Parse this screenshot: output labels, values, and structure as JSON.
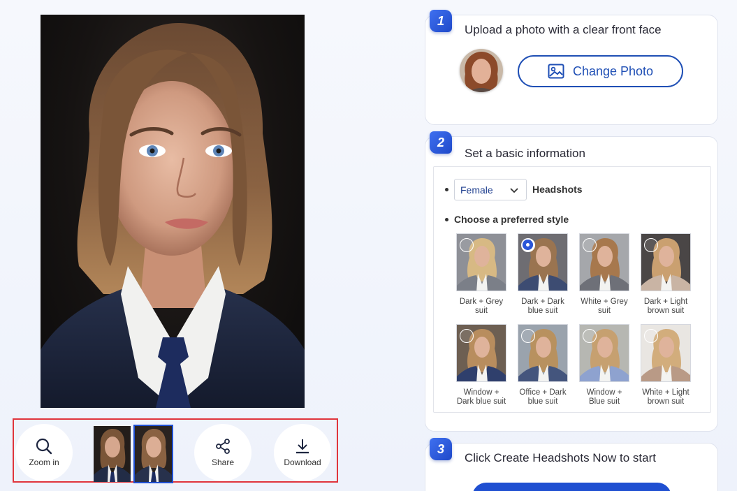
{
  "preview": {
    "toolbar": {
      "zoom_label": "Zoom in",
      "share_label": "Share",
      "download_label": "Download"
    }
  },
  "step1": {
    "number": "1",
    "title": "Upload a photo with a clear front face",
    "change_photo_label": "Change Photo"
  },
  "step2": {
    "number": "2",
    "title": "Set a basic information",
    "gender_value": "Female",
    "headshots_label": "Headshots",
    "choose_style_label": "Choose a preferred style",
    "styles": [
      {
        "line1": "Dark + Grey",
        "line2": "suit",
        "selected": false
      },
      {
        "line1": "Dark + Dark",
        "line2": "blue suit",
        "selected": true
      },
      {
        "line1": "White + Grey",
        "line2": "suit",
        "selected": false
      },
      {
        "line1": "Dark + Light",
        "line2": "brown suit",
        "selected": false
      },
      {
        "line1": "Window +",
        "line2": "Dark blue suit",
        "selected": false
      },
      {
        "line1": "Office + Dark",
        "line2": "blue suit",
        "selected": false
      },
      {
        "line1": "Window +",
        "line2": "Blue suit",
        "selected": false
      },
      {
        "line1": "White + Light",
        "line2": "brown suit",
        "selected": false
      }
    ]
  },
  "step3": {
    "number": "3",
    "title": "Click Create Headshots Now to start"
  },
  "colors": {
    "accent": "#1f4fd1",
    "highlight_border": "#e0353c"
  }
}
